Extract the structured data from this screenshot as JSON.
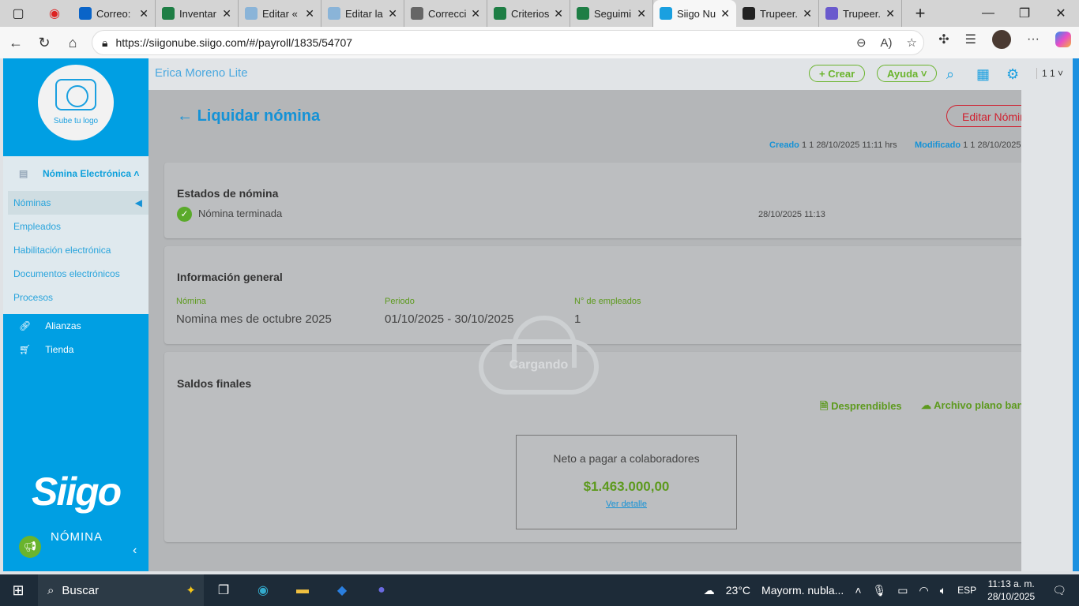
{
  "browser": {
    "tabs": [
      {
        "label": "Correo: I",
        "color": "#0a64c8"
      },
      {
        "label": "Inventar",
        "color": "#1e7e45"
      },
      {
        "label": "Editar «",
        "color": "#8ab4d8"
      },
      {
        "label": "Editar la",
        "color": "#8ab4d8"
      },
      {
        "label": "Correcci",
        "color": "#666"
      },
      {
        "label": "Criterios",
        "color": "#1e7e45"
      },
      {
        "label": "Seguimi",
        "color": "#1e7e45"
      },
      {
        "label": "Siigo Nu",
        "color": "#1aa0e0",
        "active": true
      },
      {
        "label": "Trupeer.",
        "color": "#222"
      },
      {
        "label": "Trupeer.",
        "color": "#6a5acd"
      }
    ],
    "url": "https://siigonube.siigo.com/#/payroll/1835/54707"
  },
  "sidebar": {
    "logo_text": "Sube tu logo",
    "section": "Nómina Electrónica",
    "items": [
      "Nóminas",
      "Empleados",
      "Habilitación electrónica",
      "Documentos electrónicos",
      "Procesos"
    ],
    "main_items": [
      "Alianzas",
      "Tienda"
    ],
    "brand": "Siigo",
    "brand_sub": "NÓMINA"
  },
  "topbar": {
    "company": "Erica Moreno Lite",
    "create": "+ Crear",
    "help": "Ayuda",
    "user": "1 1"
  },
  "page": {
    "title": "Liquidar nómina",
    "edit_button": "Editar Nómina",
    "created_label": "Creado",
    "created_value": "1 1 28/10/2025 11:11 hrs",
    "modified_label": "Modificado",
    "modified_value": "1 1 28/10/2025"
  },
  "status": {
    "heading": "Estados de nómina",
    "state": "Nómina terminada",
    "date": "28/10/2025 11:13"
  },
  "info": {
    "heading": "Información general",
    "fields": [
      {
        "label": "Nómina",
        "value": "Nomina mes de octubre 2025"
      },
      {
        "label": "Periodo",
        "value": "01/10/2025 - 30/10/2025"
      },
      {
        "label": "N° de empleados",
        "value": "1"
      }
    ]
  },
  "balances": {
    "heading": "Saldos finales",
    "payslips": "Desprendibles",
    "bank_file": "Archivo plano bancario",
    "net_label": "Neto a pagar a colaboradores",
    "net_value": "$1.463.000,00",
    "detail_link": "Ver detalle"
  },
  "loading": "Cargando",
  "taskbar": {
    "search": "Buscar",
    "weather": "23°C",
    "weather_desc": "Mayorm. nubla...",
    "lang": "ESP",
    "time": "11:13 a. m.",
    "date": "28/10/2025"
  }
}
